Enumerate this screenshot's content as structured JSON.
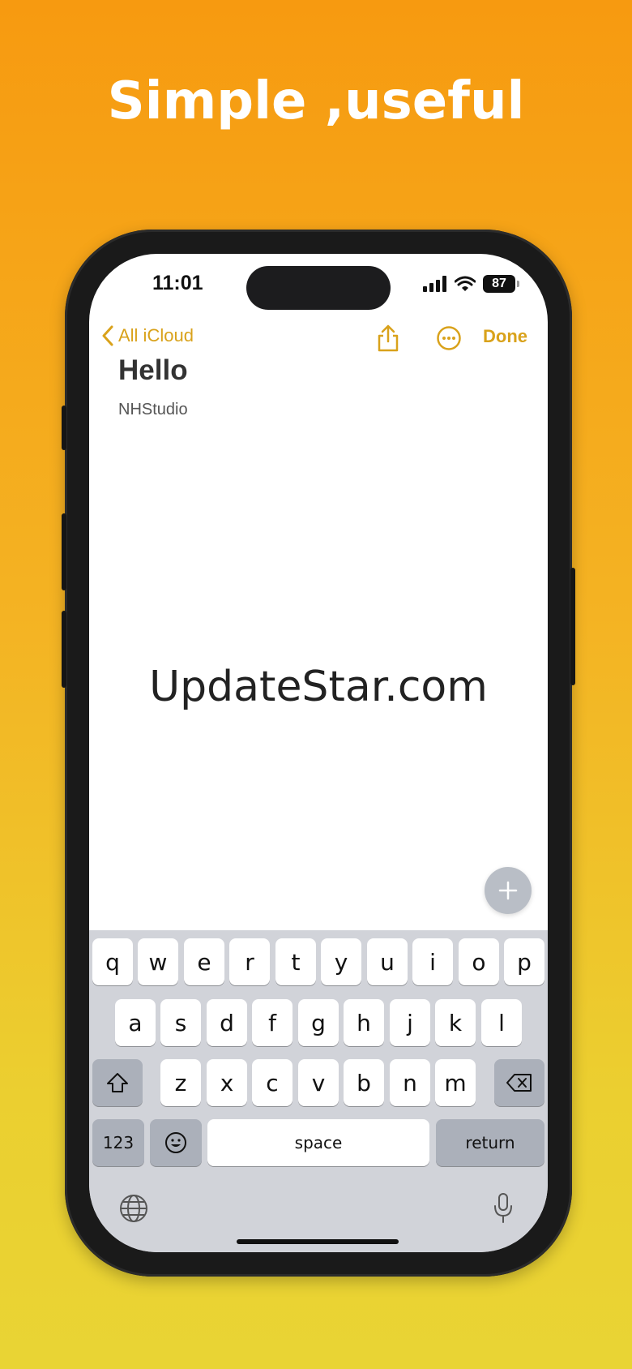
{
  "headline": "Simple ,useful",
  "status_bar": {
    "time": "11:01",
    "battery": "87"
  },
  "nav": {
    "back_label": "All iCloud",
    "done_label": "Done",
    "share_icon": "share-icon",
    "more_icon": "ellipsis-circle-icon"
  },
  "note": {
    "title": "Hello",
    "body": "NHStudio"
  },
  "watermark": "UpdateStar.com",
  "keyboard": {
    "row1": [
      "q",
      "w",
      "e",
      "r",
      "t",
      "y",
      "u",
      "i",
      "o",
      "p"
    ],
    "row2": [
      "a",
      "s",
      "d",
      "f",
      "g",
      "h",
      "j",
      "k",
      "l"
    ],
    "row3": [
      "z",
      "x",
      "c",
      "v",
      "b",
      "n",
      "m"
    ],
    "numbers_label": "123",
    "space_label": "space",
    "return_label": "return"
  },
  "colors": {
    "accent": "#d9a21b",
    "keyboard_bg": "#d1d3d9"
  }
}
